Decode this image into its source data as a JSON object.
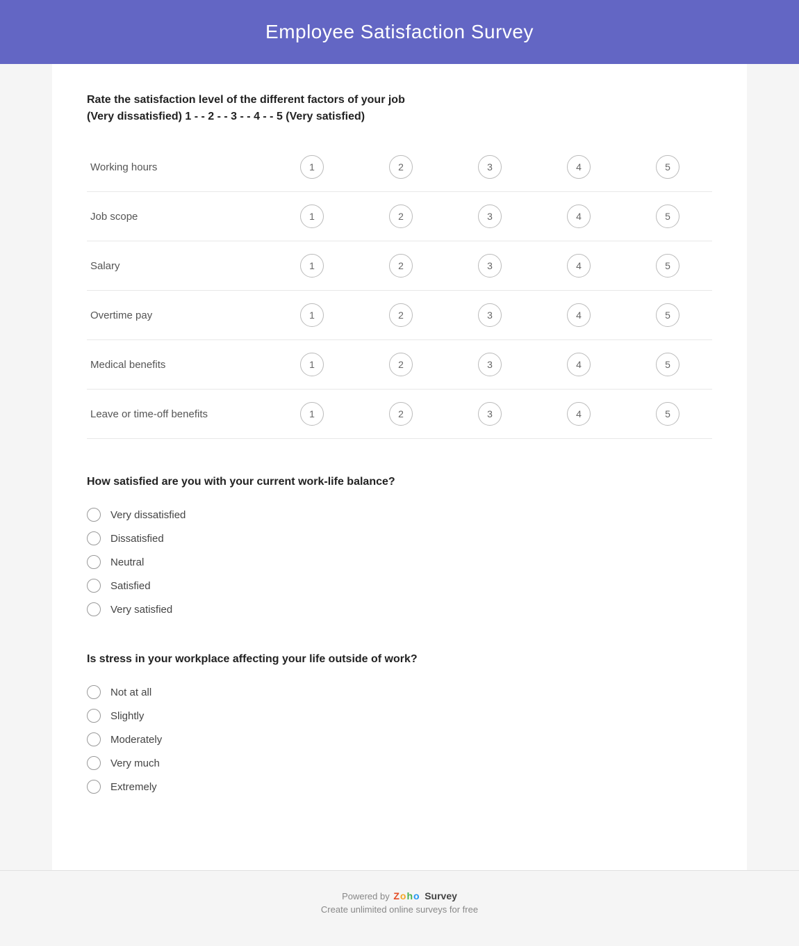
{
  "header": {
    "title": "Employee Satisfaction Survey"
  },
  "section1": {
    "title": "Rate the satisfaction level of the different factors of your job\n(Very dissatisfied) 1 - - 2 - - 3 - - 4 - - 5 (Very satisfied)",
    "rows": [
      {
        "label": "Working hours"
      },
      {
        "label": "Job scope"
      },
      {
        "label": "Salary"
      },
      {
        "label": "Overtime pay"
      },
      {
        "label": "Medical benefits"
      },
      {
        "label": "Leave or time-off benefits"
      }
    ],
    "scale": [
      "1",
      "2",
      "3",
      "4",
      "5"
    ]
  },
  "section2": {
    "title": "How satisfied are you with your current work-life balance?",
    "options": [
      "Very dissatisfied",
      "Dissatisfied",
      "Neutral",
      "Satisfied",
      "Very satisfied"
    ]
  },
  "section3": {
    "title": "Is stress in your workplace affecting your life outside of work?",
    "options": [
      "Not at all",
      "Slightly",
      "Moderately",
      "Very much",
      "Extremely"
    ]
  },
  "footer": {
    "powered_by": "Powered by",
    "zoho": {
      "z": "Z",
      "o1": "o",
      "h": "h",
      "o2": "o"
    },
    "survey_word": "Survey",
    "tagline": "Create unlimited online surveys for free"
  }
}
